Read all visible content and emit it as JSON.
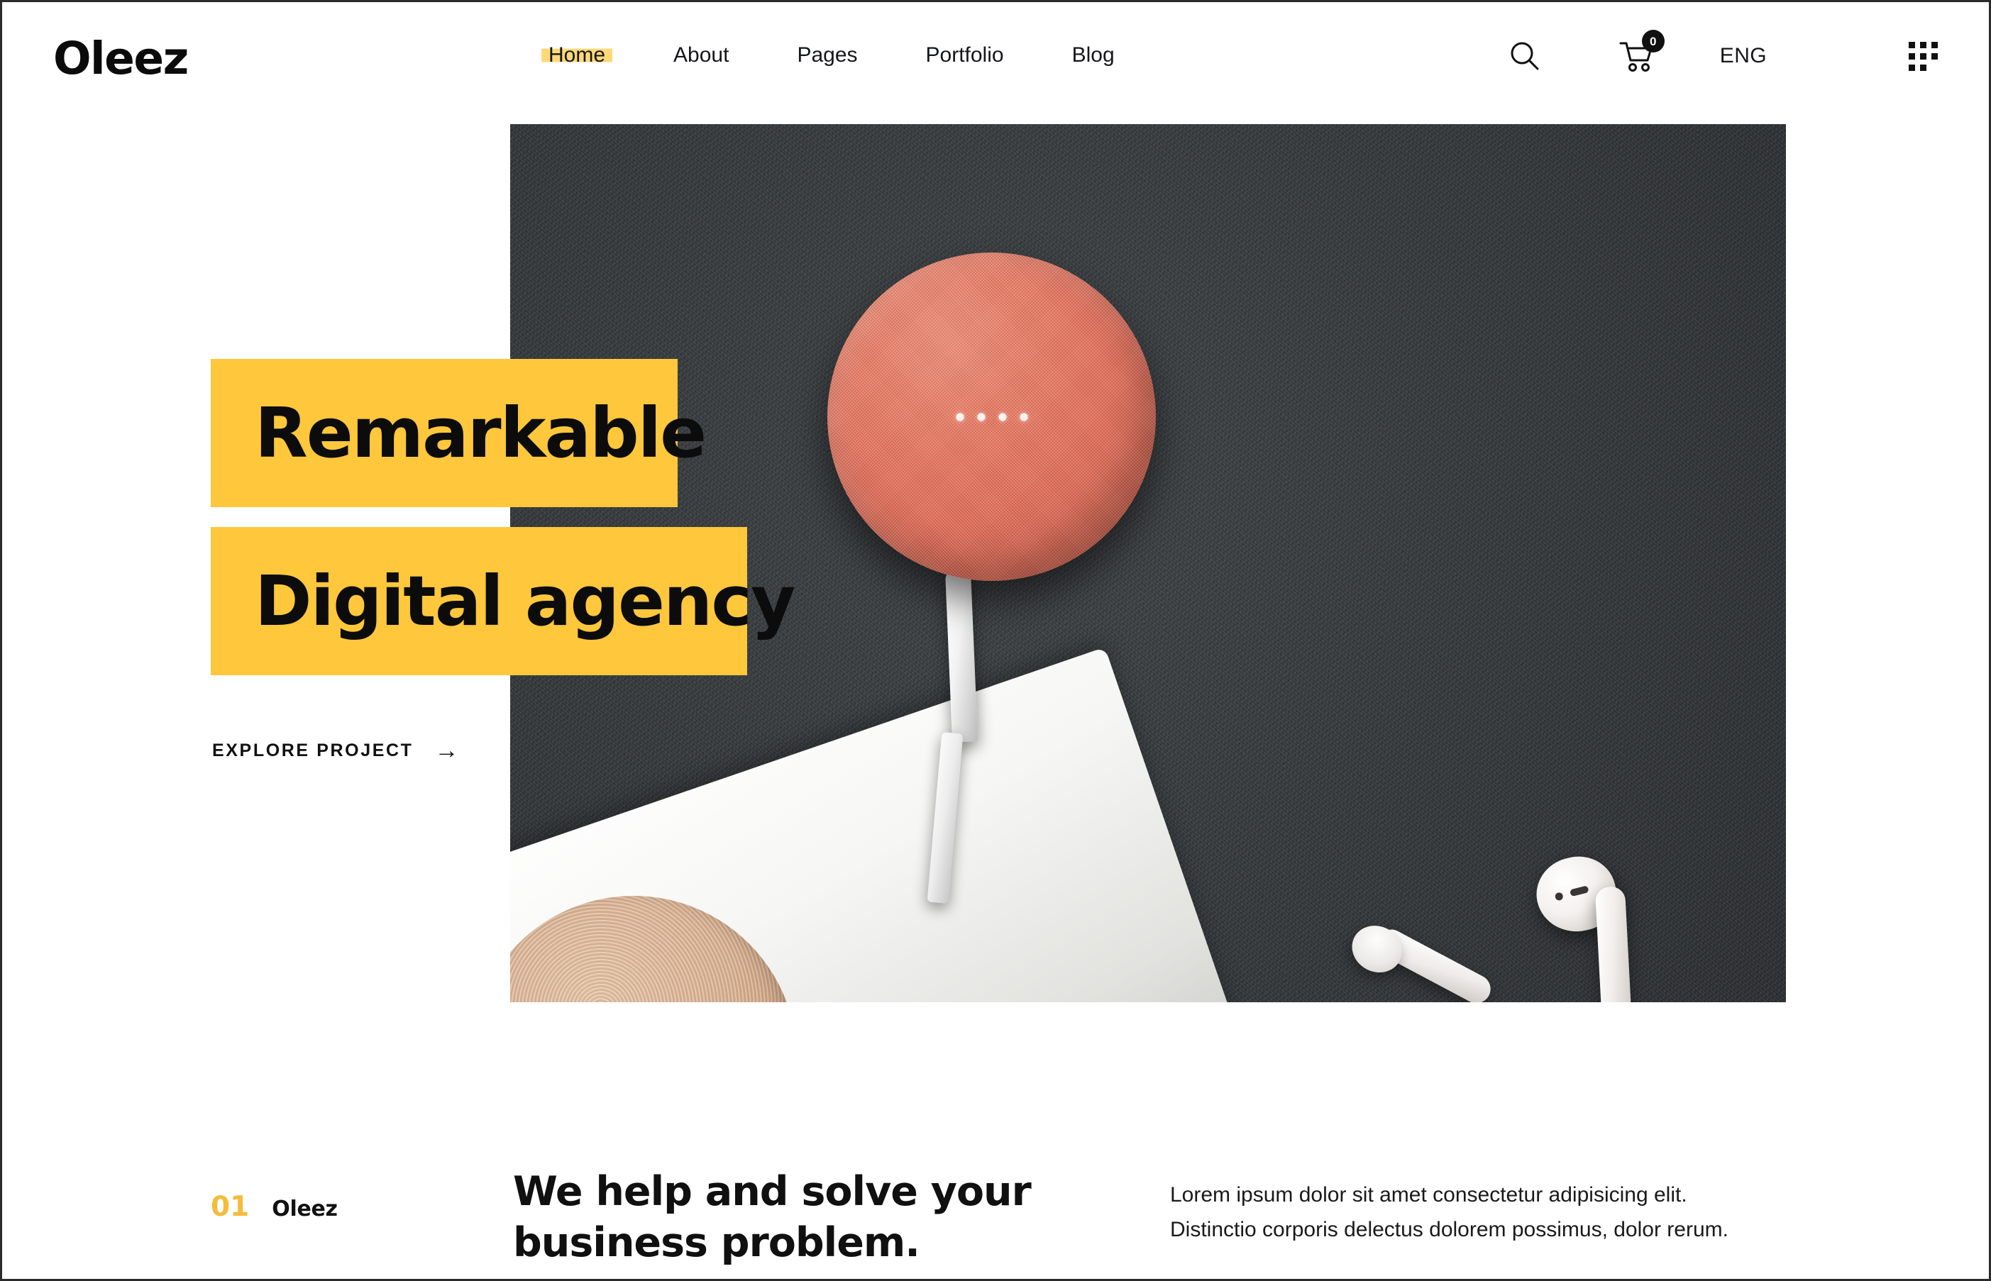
{
  "brand": {
    "name": "Oleez"
  },
  "nav": {
    "items": [
      {
        "label": "Home",
        "active": true
      },
      {
        "label": "About",
        "active": false
      },
      {
        "label": "Pages",
        "active": false
      },
      {
        "label": "Portfolio",
        "active": false
      },
      {
        "label": "Blog",
        "active": false
      }
    ]
  },
  "header_actions": {
    "search_icon": "search-icon",
    "cart_icon": "shopping-cart-icon",
    "cart_count": "0",
    "language": "ENG",
    "grid_icon": "grid-menu-icon"
  },
  "hero": {
    "headline_line_1": "Remarkable",
    "headline_line_2": "Digital agency",
    "cta_label": "EXPLORE PROJECT",
    "cta_arrow": "→",
    "image_alt": "coral smart speaker on dark felt surface with white earbuds",
    "accent_color": "#ffc73c",
    "photo_background_color": "#363a3d",
    "speaker_color": "#e9705a"
  },
  "about": {
    "index_number": "01",
    "index_label": "Oleez",
    "heading": "We help and solve your business problem.",
    "paragraph_line_1": "Lorem ipsum dolor sit amet consectetur adipisicing elit.",
    "paragraph_line_2": "Distinctio corporis delectus dolorem possimus, dolor rerum."
  },
  "colors": {
    "accent_yellow": "#ffc73c",
    "nav_highlight": "#ffd978",
    "index_yellow": "#f5bb3a",
    "text_dark": "#111111"
  }
}
